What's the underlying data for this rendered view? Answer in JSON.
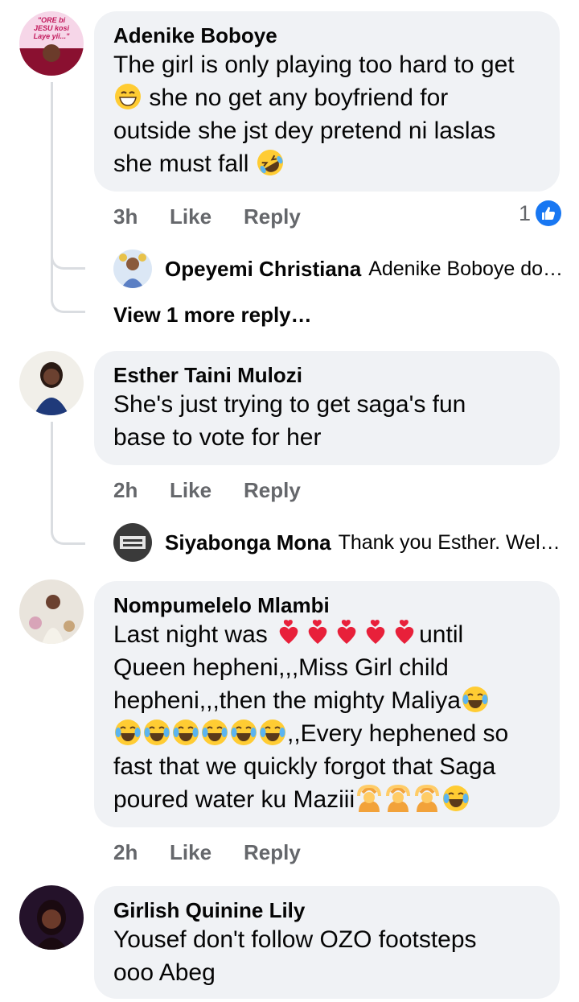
{
  "comments": [
    {
      "author": "Adenike Boboye",
      "avatar_text": "\"ORE bi JESU kosi Laye yii...\"",
      "lines": [
        "The girl is only playing too hard to get",
        "{grin} she no get any boyfriend for",
        "outside she jst dey pretend ni  laslas",
        "she must fall {rofl}"
      ],
      "time": "3h",
      "like": "Like",
      "reply": "Reply",
      "reaction_count": "1",
      "replies": [
        {
          "name": "Opeyemi Christiana",
          "text": "Adenike Boboye do…"
        }
      ],
      "more_replies": "View 1 more reply…"
    },
    {
      "author": "Esther Taini Mulozi",
      "lines": [
        "She's just trying to get saga's fun",
        "base to vote for her"
      ],
      "time": "2h",
      "like": "Like",
      "reply": "Reply",
      "replies": [
        {
          "name": "Siyabonga Mona",
          "text": "Thank you Esther. Wel…"
        }
      ]
    },
    {
      "author": "Nompumelelo Mlambi",
      "lines": [
        "Last night was {hearts}until",
        "Queen hepheni,,,Miss Girl child",
        "hepheni,,,then the mighty Maliya{joy}",
        "{joy6},,Every hephened so",
        "fast that we quickly forgot that Saga",
        "poured water ku Maziii{ok3}{joy}"
      ],
      "time": "2h",
      "like": "Like",
      "reply": "Reply"
    },
    {
      "author": "Girlish Quinine Lily",
      "lines": [
        "Yousef don't follow OZO footsteps",
        "ooo Abeg"
      ]
    }
  ],
  "icons": {
    "like": "thumbs-up-icon",
    "grin": "grinning-face-icon",
    "rofl": "rolling-laughing-icon",
    "heart": "two-hearts-icon",
    "joy": "tears-of-joy-icon",
    "ok": "ok-gesture-icon"
  },
  "colors": {
    "bubble": "#f0f2f5",
    "muted": "#65676b",
    "accent": "#1877f2",
    "thread": "#dadde1"
  }
}
